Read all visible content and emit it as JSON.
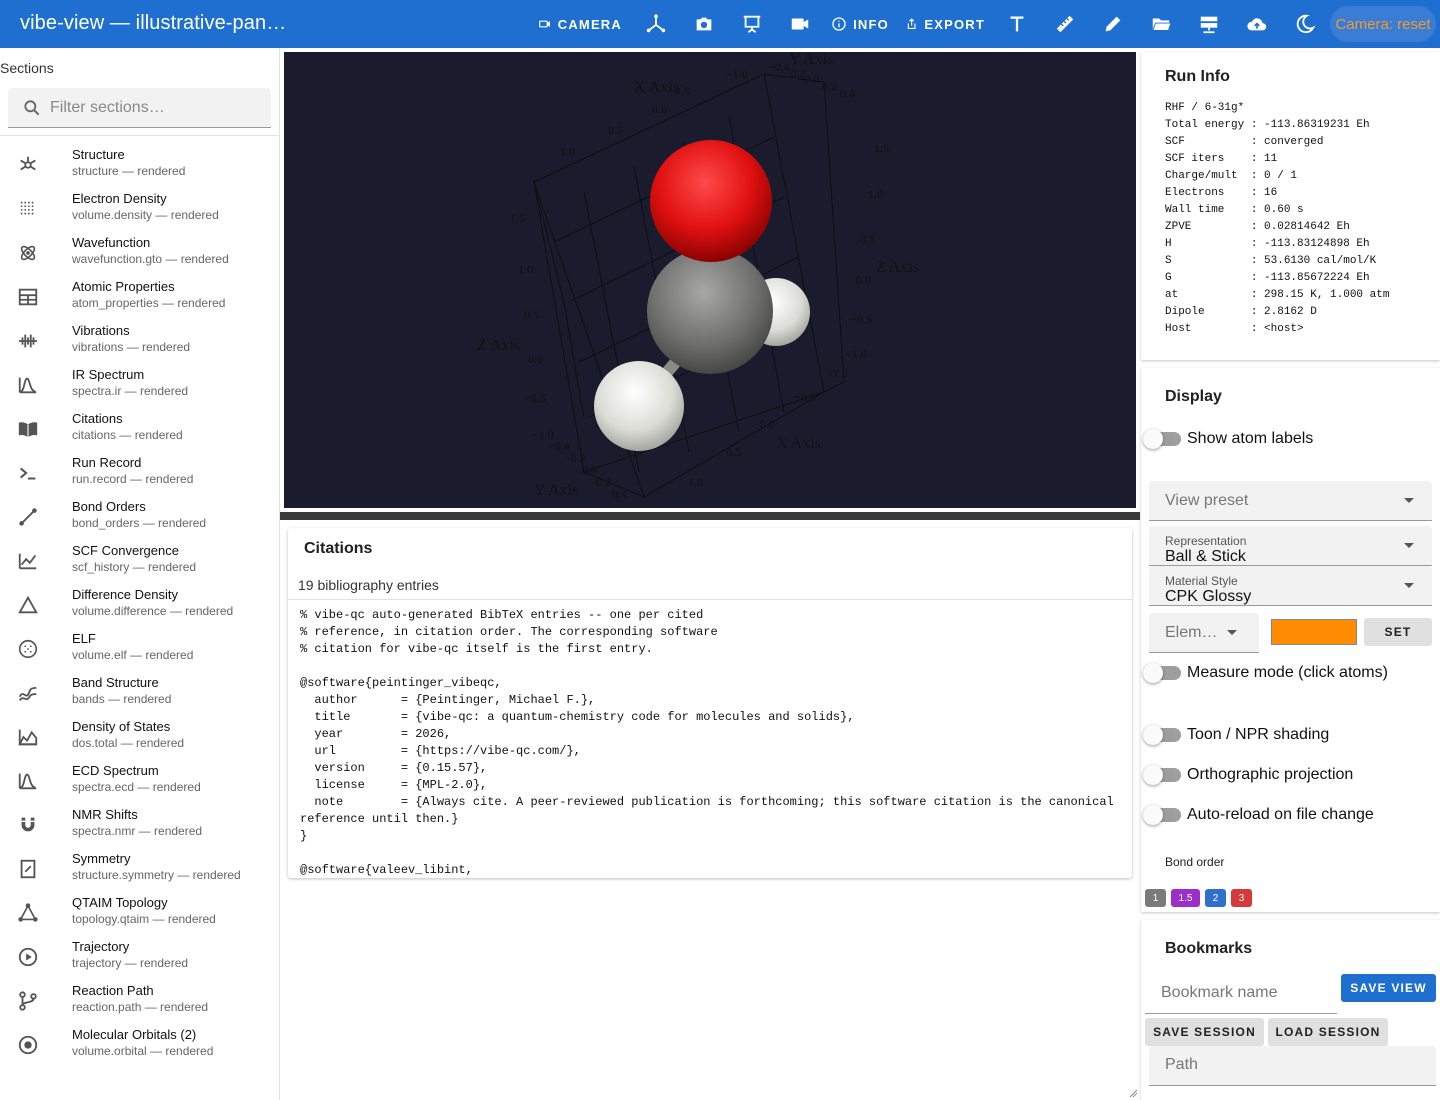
{
  "window": {
    "title": "vibe-view — illustrative-pan…"
  },
  "toolbar": {
    "camera_label": "CAMERA",
    "info_label": "INFO",
    "export_label": "EXPORT",
    "camera_reset_label": "Camera: reset",
    "icons": [
      "camera-icon",
      "axes-icon",
      "screenshot-icon",
      "presentation-icon",
      "video-icon",
      "info-icon",
      "export-icon",
      "text-icon",
      "ruler-icon",
      "pencil-icon",
      "folder-open-icon",
      "server-icon",
      "cloud-upload-icon",
      "dark-mode-icon"
    ],
    "accent_color": "#1e6fd0",
    "reset_color": "#f39a2b"
  },
  "sidebar": {
    "header": "Sections",
    "filter_placeholder": "Filter sections…",
    "items": [
      {
        "title": "Structure",
        "subtitle": "structure — rendered",
        "icon": "molecule-icon"
      },
      {
        "title": "Electron Density",
        "subtitle": "volume.density — rendered",
        "icon": "dot-grid-icon"
      },
      {
        "title": "Wavefunction",
        "subtitle": "wavefunction.gto — rendered",
        "icon": "atom-icon"
      },
      {
        "title": "Atomic Properties",
        "subtitle": "atom_properties — rendered",
        "icon": "table-icon"
      },
      {
        "title": "Vibrations",
        "subtitle": "vibrations — rendered",
        "icon": "waveform-icon"
      },
      {
        "title": "IR Spectrum",
        "subtitle": "spectra.ir — rendered",
        "icon": "spectrum-icon"
      },
      {
        "title": "Citations",
        "subtitle": "citations — rendered",
        "icon": "book-icon"
      },
      {
        "title": "Run Record",
        "subtitle": "run.record — rendered",
        "icon": "terminal-icon"
      },
      {
        "title": "Bond Orders",
        "subtitle": "bond_orders — rendered",
        "icon": "bond-icon"
      },
      {
        "title": "SCF Convergence",
        "subtitle": "scf_history — rendered",
        "icon": "line-chart-icon"
      },
      {
        "title": "Difference Density",
        "subtitle": "volume.difference — rendered",
        "icon": "triangle-icon"
      },
      {
        "title": "ELF",
        "subtitle": "volume.elf — rendered",
        "icon": "dotted-circle-icon"
      },
      {
        "title": "Band Structure",
        "subtitle": "bands — rendered",
        "icon": "bands-icon"
      },
      {
        "title": "Density of States",
        "subtitle": "dos.total — rendered",
        "icon": "area-chart-icon"
      },
      {
        "title": "ECD Spectrum",
        "subtitle": "spectra.ecd — rendered",
        "icon": "spectrum-icon"
      },
      {
        "title": "NMR Shifts",
        "subtitle": "spectra.nmr — rendered",
        "icon": "magnet-icon"
      },
      {
        "title": "Symmetry",
        "subtitle": "structure.symmetry — rendered",
        "icon": "symmetry-icon"
      },
      {
        "title": "QTAIM Topology",
        "subtitle": "topology.qtaim — rendered",
        "icon": "graph-icon"
      },
      {
        "title": "Trajectory",
        "subtitle": "trajectory — rendered",
        "icon": "play-circle-icon"
      },
      {
        "title": "Reaction Path",
        "subtitle": "reaction.path — rendered",
        "icon": "branch-icon"
      },
      {
        "title": "Molecular Orbitals (2)",
        "subtitle": "volume.orbital — rendered",
        "icon": "orbital-icon"
      }
    ]
  },
  "viewer": {
    "axis_titles": {
      "x_top": "X Axis",
      "y_top": "Y Axis",
      "z_left": "Z Axis",
      "z_right": "Z Axis",
      "x_bottom": "X Axis",
      "y_bottom": "Y Axis"
    },
    "ticks": {
      "x_top": [
        "−1.0",
        "−0.5",
        "0.0",
        "0.5",
        "1.0"
      ],
      "y_top": [
        "−0.4",
        "−0.2",
        "0.0",
        "0.2",
        "0.4"
      ],
      "z_right": [
        "1.5",
        "1.0",
        "0.5",
        "0.0",
        "−0.5",
        "−1.0"
      ],
      "z_left": [
        "1.5",
        "1.0",
        "0.5",
        "0.0",
        "−0.5",
        "−1.0"
      ],
      "x_bottom": [
        "−1.0",
        "−0.5",
        "0.0",
        "0.5",
        "1.0"
      ],
      "y_bottom": [
        "−0.4",
        "−0.2",
        "0.0",
        "0.2",
        "0.4"
      ]
    },
    "background": "#1b1b2e",
    "atom_colors": {
      "oxygen": "#e01010",
      "carbon": "#8a8a88",
      "hydrogen": "#e8e8e4"
    }
  },
  "citations": {
    "title": "Citations",
    "count_text": "19 bibliography entries",
    "bibtex": "% vibe-qc auto-generated BibTeX entries -- one per cited\n% reference, in citation order. The corresponding software\n% citation for vibe-qc itself is the first entry.\n\n@software{peintinger_vibeqc,\n  author      = {Peintinger, Michael F.},\n  title       = {vibe-qc: a quantum-chemistry code for molecules and solids},\n  year        = 2026,\n  url         = {https://vibe-qc.com/},\n  version     = {0.15.57},\n  license     = {MPL-2.0},\n  note        = {Always cite. A peer-reviewed publication is forthcoming; this software citation is the canonical reference until then.}\n}\n\n@software{valeev_libint,"
  },
  "run_info": {
    "title": "Run Info",
    "text": "RHF / 6-31g*\nTotal energy : -113.86319231 Eh\nSCF          : converged\nSCF iters    : 11\nCharge/mult  : 0 / 1\nElectrons    : 16\nWall time    : 0.60 s\nZPVE         : 0.02814642 Eh\nH            : -113.83124898 Eh\nS            : 53.6130 cal/mol/K\nG            : -113.85672224 Eh\nat           : 298.15 K, 1.000 atm\nDipole       : 2.8162 D\nHost         : <host>"
  },
  "display": {
    "title": "Display",
    "show_atom_labels": "Show atom labels",
    "view_preset_placeholder": "View preset",
    "representation_label": "Representation",
    "representation_value": "Ball & Stick",
    "material_label": "Material Style",
    "material_value": "CPK Glossy",
    "element_placeholder": "Elem…",
    "element_color": "#ff8c00",
    "set_label": "SET",
    "measure_mode": "Measure mode (click atoms)",
    "toon_shading": "Toon / NPR shading",
    "orthographic": "Orthographic projection",
    "auto_reload": "Auto-reload on file change",
    "bond_order_label": "Bond order",
    "bond_orders": [
      {
        "label": "1",
        "color": "#7a7a7a"
      },
      {
        "label": "1.5",
        "color": "#9c2fc9"
      },
      {
        "label": "2",
        "color": "#2f6fd0"
      },
      {
        "label": "3",
        "color": "#d43a3a"
      }
    ]
  },
  "bookmarks": {
    "title": "Bookmarks",
    "name_placeholder": "Bookmark name",
    "save_view": "SAVE VIEW",
    "save_session": "SAVE SESSION",
    "load_session": "LOAD SESSION",
    "path_placeholder": "Path"
  }
}
